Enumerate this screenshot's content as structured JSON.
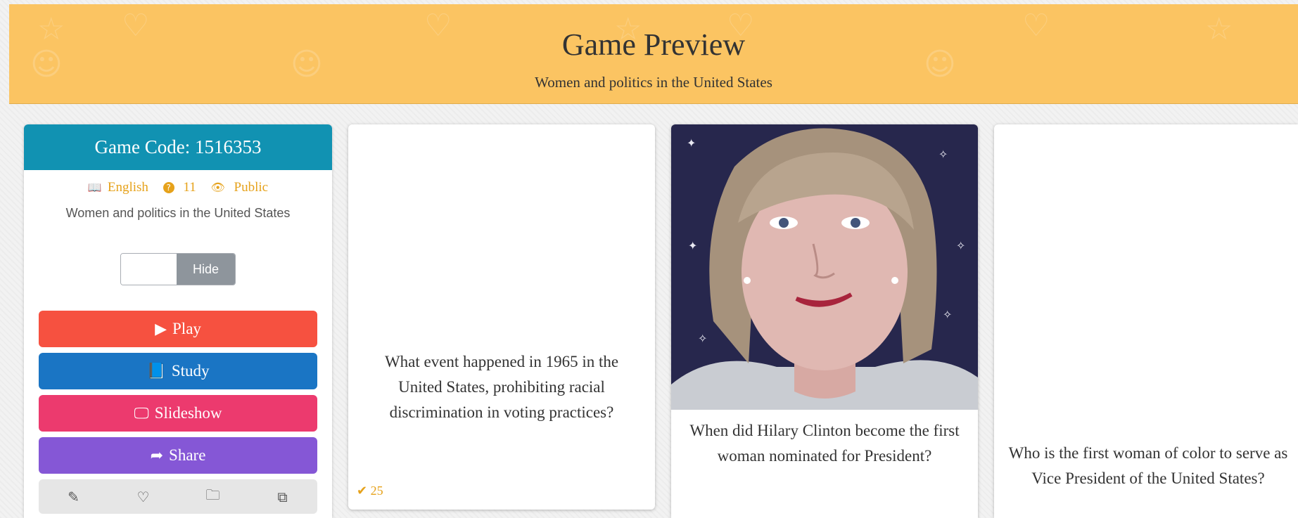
{
  "header": {
    "title": "Game Preview",
    "subtitle": "Women and politics in the United States"
  },
  "panel": {
    "code_label": "Game Code: 1516353",
    "language": "English",
    "question_count": "11",
    "visibility": "Public",
    "description": "Women and politics in the United States",
    "toggle_label": "Hide",
    "buttons": {
      "play": "Play",
      "study": "Study",
      "slideshow": "Slideshow",
      "share": "Share"
    },
    "tools": [
      "pencil-icon",
      "heart-icon",
      "folder-icon",
      "copy-icon"
    ]
  },
  "cards": [
    {
      "question": "What event happened in 1965 in the United States, prohibiting racial discrimination in voting practices?",
      "correct_count": "25"
    },
    {
      "question": "When did Hilary Clinton become the first woman nominated for President?"
    },
    {
      "question": "Who is the first woman of color to serve as Vice President of the United States?"
    }
  ],
  "colors": {
    "header_bg": "#fbc462",
    "code_bar": "#1192b2",
    "play": "#f65140",
    "study": "#1a75c4",
    "slideshow": "#ec3a6e",
    "share": "#8557d6",
    "accent": "#e6a21b"
  }
}
